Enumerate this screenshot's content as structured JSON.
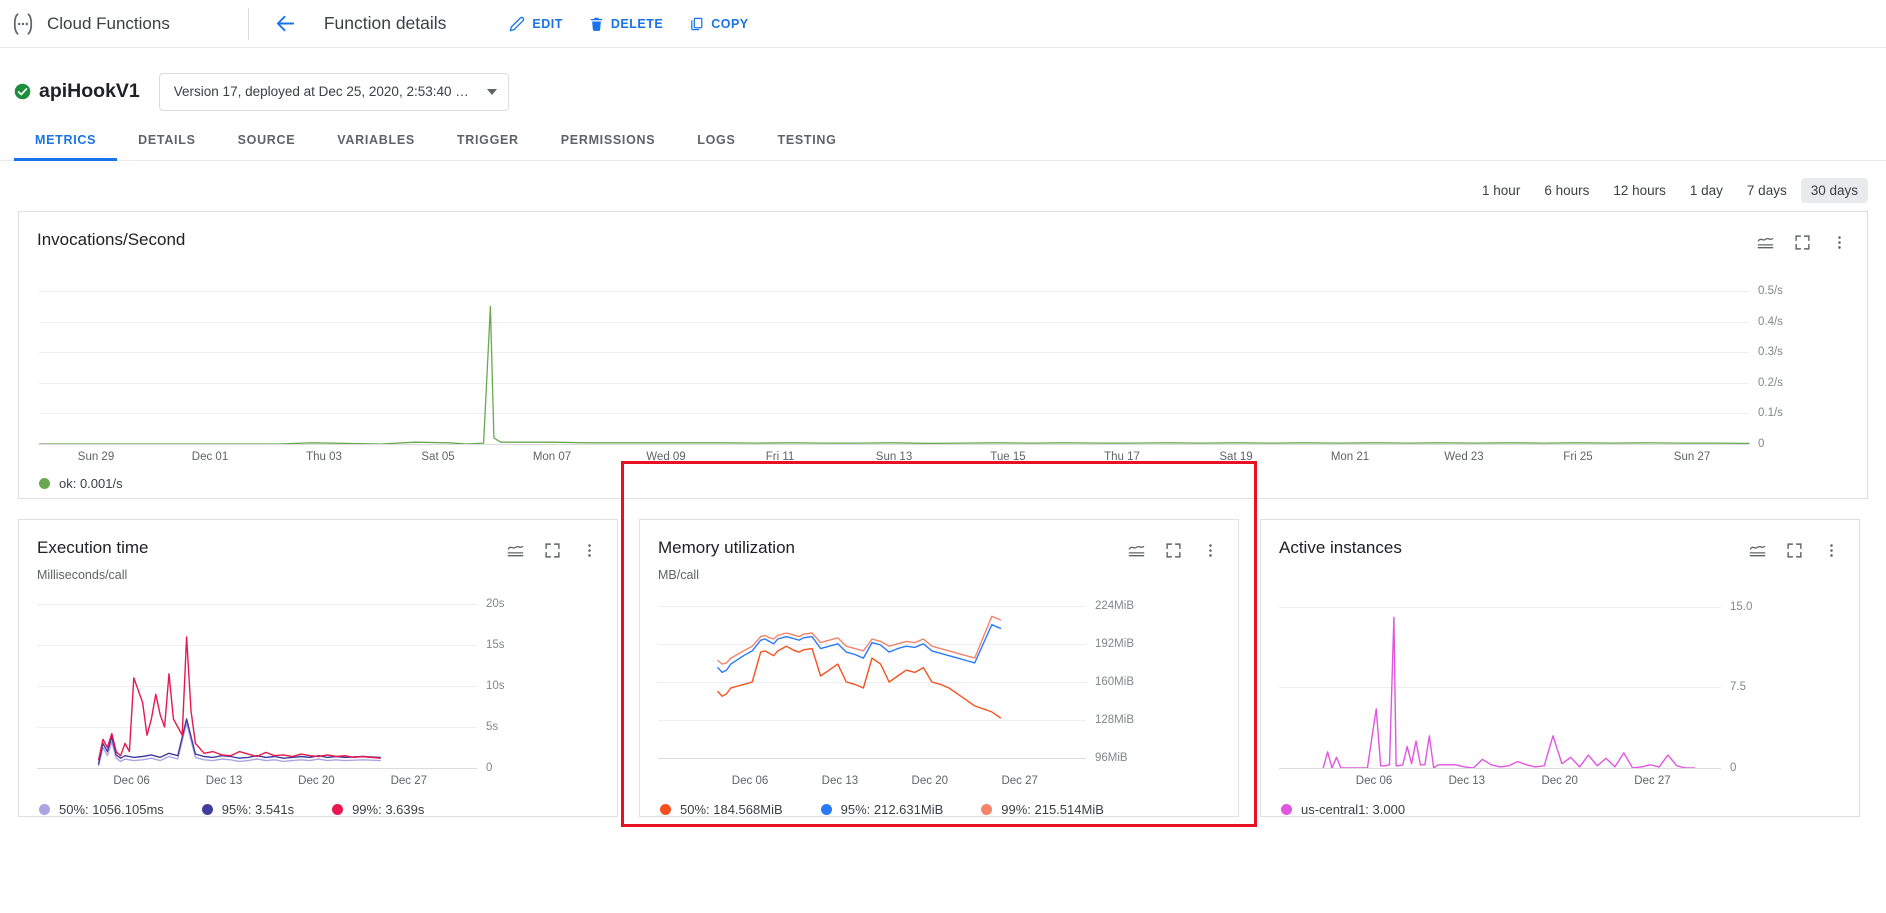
{
  "topbar": {
    "logo_icon": "cloud-functions-logo-icon",
    "product": "Cloud Functions",
    "back_icon": "back-arrow-icon",
    "page_title": "Function details",
    "actions": [
      {
        "label": "EDIT",
        "icon": "pencil-icon"
      },
      {
        "label": "DELETE",
        "icon": "trash-icon"
      },
      {
        "label": "COPY",
        "icon": "copy-icon"
      }
    ]
  },
  "function_header": {
    "status_icon": "check-circle-icon",
    "status_color": "#1e8e3e",
    "name": "apiHookV1",
    "version_label": "Version 17, deployed at Dec 25, 2020, 2:53:40 …",
    "dropdown_icon": "chevron-down-icon"
  },
  "tabs": [
    {
      "label": "METRICS",
      "active": true
    },
    {
      "label": "DETAILS",
      "active": false
    },
    {
      "label": "SOURCE",
      "active": false
    },
    {
      "label": "VARIABLES",
      "active": false
    },
    {
      "label": "TRIGGER",
      "active": false
    },
    {
      "label": "PERMISSIONS",
      "active": false
    },
    {
      "label": "LOGS",
      "active": false
    },
    {
      "label": "TESTING",
      "active": false
    }
  ],
  "time_range": {
    "options": [
      "1 hour",
      "6 hours",
      "12 hours",
      "1 day",
      "7 days",
      "30 days"
    ],
    "selected": "30 days"
  },
  "card_icons": {
    "chart_type": "line-chart-icon",
    "fullscreen": "fullscreen-icon",
    "more": "more-vert-icon"
  },
  "annotation": {
    "color": "#e81123",
    "target": "memory-utilization-card"
  },
  "chart_data": [
    {
      "id": "invocations",
      "type": "line",
      "title": "Invocations/Second",
      "subtitle": "",
      "xlabel": "",
      "ylabel": "",
      "ylim": [
        0,
        0.55
      ],
      "grid": true,
      "legend_position": "bottom-left",
      "yticks": [
        "0",
        "0.1/s",
        "0.2/s",
        "0.3/s",
        "0.4/s",
        "0.5/s"
      ],
      "ytick_values": [
        0,
        0.1,
        0.2,
        0.3,
        0.4,
        0.5
      ],
      "xticks": [
        "Sun 29",
        "Dec 01",
        "Thu 03",
        "Sat 05",
        "Mon 07",
        "Wed 09",
        "Fri 11",
        "Sun 13",
        "Tue 15",
        "Thu 17",
        "Sat 19",
        "Mon 21",
        "Wed 23",
        "Fri 25",
        "Sun 27"
      ],
      "legend": [
        {
          "name": "ok",
          "value": "0.001/s",
          "label": "ok: 0.001/s",
          "color": "#6aa84f"
        }
      ],
      "series": [
        {
          "name": "ok",
          "color": "#6aa84f",
          "x": [
            0,
            2,
            4,
            6,
            8,
            10,
            12,
            14,
            16,
            18,
            20,
            22,
            24,
            25,
            26,
            26.4,
            26.6,
            27,
            28,
            30,
            32,
            34,
            36,
            38,
            40,
            42,
            44,
            46,
            48,
            50,
            52,
            54,
            56,
            58,
            60,
            62,
            64,
            66,
            68,
            70,
            72,
            74,
            76,
            78,
            80,
            82,
            84,
            86,
            88,
            90,
            92,
            94,
            96,
            98,
            100
          ],
          "values": [
            0,
            0,
            0,
            0,
            0,
            0,
            0,
            0,
            0.004,
            0.002,
            0,
            0.006,
            0.004,
            0,
            0.003,
            0.45,
            0.02,
            0.006,
            0.006,
            0.006,
            0.004,
            0.004,
            0.004,
            0.004,
            0.004,
            0.003,
            0.004,
            0.003,
            0.003,
            0.004,
            0.002,
            0.003,
            0.004,
            0.003,
            0.004,
            0.003,
            0.003,
            0.004,
            0.003,
            0.004,
            0.003,
            0.004,
            0.003,
            0.004,
            0.003,
            0.004,
            0.003,
            0.004,
            0.003,
            0.004,
            0.003,
            0.004,
            0.003,
            0.003,
            0.002
          ]
        }
      ]
    },
    {
      "id": "execution-time",
      "type": "line",
      "title": "Execution time",
      "subtitle": "Milliseconds/call",
      "xlabel": "",
      "ylabel": "",
      "ylim": [
        0,
        21
      ],
      "grid": true,
      "legend_position": "bottom-left",
      "yticks": [
        "0",
        "5s",
        "10s",
        "15s",
        "20s"
      ],
      "ytick_values": [
        0,
        5,
        10,
        15,
        20
      ],
      "xticks": [
        "Dec 06",
        "Dec 13",
        "Dec 20",
        "Dec 27"
      ],
      "legend": [
        {
          "name": "50%",
          "value": "1056.105ms",
          "label": "50%: 1056.105ms",
          "color": "#aaa5e0"
        },
        {
          "name": "95%",
          "value": "3.541s",
          "label": "95%: 3.541s",
          "color": "#3f3d9e"
        },
        {
          "name": "99%",
          "value": "3.639s",
          "label": "99%: 3.639s",
          "color": "#e8174f"
        }
      ],
      "series": [
        {
          "name": "50%",
          "color": "#aaa5e0",
          "x": [
            14,
            15,
            16,
            17,
            18,
            19,
            20,
            22,
            24,
            26,
            28,
            30,
            32,
            34,
            36,
            38,
            40,
            42,
            44,
            46,
            48,
            50,
            52,
            54,
            56,
            58,
            60,
            62,
            64,
            66,
            68,
            70,
            74,
            78
          ],
          "values": [
            0.3,
            2.5,
            1.5,
            3.2,
            1.2,
            0.8,
            1.1,
            0.9,
            1.0,
            1.2,
            0.9,
            1.4,
            1.1,
            5.5,
            1.3,
            1.0,
            0.9,
            1.1,
            1.0,
            0.8,
            0.9,
            1.1,
            0.9,
            1.0,
            0.8,
            0.9,
            1.0,
            0.9,
            1.1,
            0.9,
            1.0,
            0.9,
            1.0,
            0.9
          ]
        },
        {
          "name": "95%",
          "color": "#3f3d9e",
          "x": [
            14,
            15,
            16,
            17,
            18,
            19,
            20,
            22,
            24,
            26,
            28,
            30,
            32,
            34,
            36,
            38,
            40,
            42,
            44,
            46,
            48,
            50,
            52,
            54,
            56,
            58,
            60,
            62,
            64,
            66,
            68,
            70,
            74,
            78
          ],
          "values": [
            0.5,
            3.0,
            2.0,
            3.8,
            1.6,
            1.2,
            1.5,
            1.3,
            1.4,
            1.6,
            1.3,
            1.8,
            1.5,
            6.0,
            1.7,
            1.4,
            1.3,
            1.5,
            1.4,
            1.2,
            1.3,
            1.5,
            1.3,
            1.4,
            1.2,
            1.3,
            1.4,
            1.3,
            1.5,
            1.3,
            1.4,
            1.3,
            1.4,
            1.3
          ]
        },
        {
          "name": "99%",
          "color": "#e8174f",
          "x": [
            14,
            15,
            16,
            17,
            18,
            19,
            20,
            21,
            22,
            24,
            25,
            26,
            27,
            28,
            29,
            30,
            31,
            32,
            33,
            34,
            35,
            36,
            38,
            40,
            42,
            44,
            46,
            48,
            50,
            52,
            54,
            56,
            58,
            60,
            62,
            64,
            66,
            68,
            70,
            72,
            74,
            76,
            78
          ],
          "values": [
            1.0,
            3.5,
            2.5,
            4.2,
            2.0,
            1.5,
            3.0,
            2.0,
            11.0,
            8.0,
            4.0,
            6.0,
            9.0,
            6.5,
            5.0,
            11.5,
            6.0,
            5.0,
            4.0,
            16.0,
            7.0,
            3.0,
            1.8,
            2.0,
            1.6,
            1.5,
            2.0,
            1.7,
            1.4,
            1.9,
            1.5,
            1.6,
            1.4,
            1.7,
            1.5,
            1.4,
            1.6,
            1.4,
            1.5,
            1.3,
            1.4,
            1.3,
            1.2
          ]
        }
      ]
    },
    {
      "id": "memory-utilization",
      "type": "line",
      "title": "Memory utilization",
      "subtitle": "MB/call",
      "xlabel": "",
      "ylabel": "",
      "ylim": [
        88,
        232
      ],
      "grid": true,
      "legend_position": "bottom-left",
      "yticks": [
        "96MiB",
        "128MiB",
        "160MiB",
        "192MiB",
        "224MiB"
      ],
      "ytick_values": [
        96,
        128,
        160,
        192,
        224
      ],
      "xticks": [
        "Dec 06",
        "Dec 13",
        "Dec 20",
        "Dec 27"
      ],
      "legend": [
        {
          "name": "50%",
          "value": "184.568MiB",
          "label": "50%: 184.568MiB",
          "color": "#f4511e"
        },
        {
          "name": "95%",
          "value": "212.631MiB",
          "label": "95%: 212.631MiB",
          "color": "#2979ff"
        },
        {
          "name": "99%",
          "value": "215.514MiB",
          "label": "99%: 215.514MiB",
          "color": "#f4836a"
        }
      ],
      "series": [
        {
          "name": "50%",
          "color": "#f4511e",
          "x": [
            14,
            15,
            16,
            17,
            20,
            22,
            24,
            25,
            26,
            27,
            28,
            30,
            31,
            32,
            33,
            34,
            36,
            38,
            40,
            42,
            44,
            46,
            48,
            50,
            52,
            54,
            56,
            58,
            60,
            62,
            64,
            66,
            68,
            70,
            72,
            74,
            78,
            80
          ],
          "values": [
            152,
            148,
            150,
            155,
            158,
            160,
            185,
            186,
            184,
            182,
            186,
            190,
            188,
            186,
            185,
            187,
            188,
            165,
            170,
            175,
            160,
            158,
            155,
            180,
            175,
            160,
            165,
            170,
            168,
            172,
            160,
            158,
            155,
            150,
            145,
            140,
            135,
            130
          ]
        },
        {
          "name": "95%",
          "color": "#2979ff",
          "x": [
            14,
            15,
            16,
            17,
            20,
            22,
            24,
            25,
            26,
            27,
            28,
            30,
            31,
            32,
            33,
            34,
            36,
            38,
            40,
            42,
            44,
            46,
            48,
            50,
            52,
            54,
            56,
            58,
            60,
            62,
            64,
            66,
            68,
            70,
            72,
            74,
            78,
            80
          ],
          "values": [
            172,
            168,
            170,
            175,
            182,
            186,
            195,
            196,
            194,
            192,
            196,
            198,
            197,
            196,
            195,
            197,
            198,
            188,
            190,
            192,
            185,
            183,
            180,
            193,
            191,
            185,
            188,
            190,
            189,
            192,
            186,
            184,
            182,
            180,
            178,
            176,
            208,
            205
          ]
        },
        {
          "name": "99%",
          "color": "#f4836a",
          "x": [
            14,
            15,
            16,
            17,
            20,
            22,
            24,
            25,
            26,
            27,
            28,
            30,
            31,
            32,
            33,
            34,
            36,
            38,
            40,
            42,
            44,
            46,
            48,
            50,
            52,
            54,
            56,
            58,
            60,
            62,
            64,
            66,
            68,
            70,
            72,
            74,
            78,
            80
          ],
          "values": [
            178,
            175,
            176,
            180,
            186,
            190,
            198,
            199,
            197,
            196,
            199,
            201,
            200,
            199,
            198,
            200,
            201,
            193,
            195,
            197,
            190,
            188,
            186,
            196,
            194,
            190,
            192,
            194,
            193,
            196,
            190,
            188,
            186,
            184,
            182,
            180,
            215,
            212
          ]
        }
      ]
    },
    {
      "id": "active-instances",
      "type": "line",
      "title": "Active instances",
      "subtitle": "",
      "xlabel": "",
      "ylabel": "",
      "ylim": [
        0,
        16
      ],
      "grid": true,
      "legend_position": "bottom-left",
      "yticks": [
        "0",
        "7.5",
        "15.0"
      ],
      "ytick_values": [
        0,
        7.5,
        15
      ],
      "xticks": [
        "Dec 06",
        "Dec 13",
        "Dec 20",
        "Dec 27"
      ],
      "legend": [
        {
          "name": "us-central1",
          "value": "3.000",
          "label": "us-central1: 3.000",
          "color": "#e255e2"
        }
      ],
      "series": [
        {
          "name": "us-central1",
          "color": "#e255e2",
          "x": [
            10,
            11,
            12,
            13,
            14,
            16,
            18,
            20,
            22,
            23,
            24,
            25,
            26,
            26.5,
            27,
            28,
            29,
            30,
            31,
            32,
            33,
            34,
            35,
            36,
            38,
            40,
            42,
            44,
            46,
            48,
            50,
            52,
            54,
            56,
            58,
            60,
            62,
            64,
            66,
            68,
            70,
            72,
            74,
            76,
            78,
            80,
            82,
            84,
            86,
            88,
            90,
            92,
            94
          ],
          "values": [
            0,
            1.5,
            0,
            1.0,
            0,
            0,
            0,
            0,
            5.5,
            0.2,
            0.2,
            0.3,
            14.0,
            0.2,
            0.2,
            0.3,
            2.0,
            0.4,
            2.5,
            0.3,
            0.3,
            3.0,
            0,
            0.3,
            0.3,
            0.3,
            0.1,
            0,
            0.8,
            0.3,
            0.1,
            0.2,
            0.6,
            0.3,
            0.1,
            0.2,
            3.0,
            0.4,
            1.0,
            0.1,
            1.2,
            0.2,
            0.9,
            0.1,
            1.4,
            0,
            0.1,
            0.3,
            0.1,
            1.2,
            0.2,
            0,
            0
          ]
        }
      ]
    }
  ]
}
